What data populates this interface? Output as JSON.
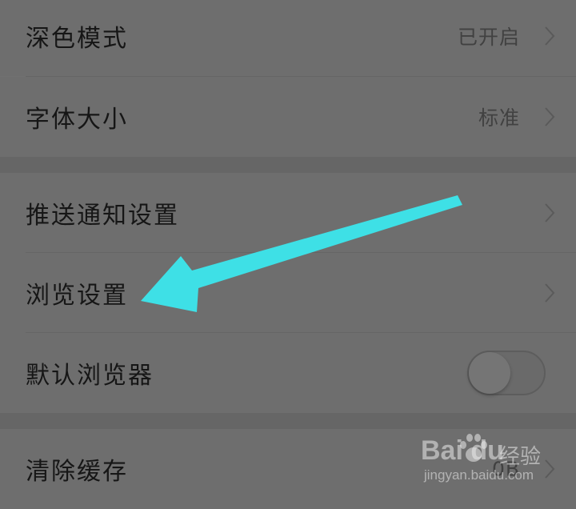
{
  "settings": {
    "dark_mode": {
      "label": "深色模式",
      "value": "已开启"
    },
    "font_size": {
      "label": "字体大小",
      "value": "标准"
    },
    "push_notifications": {
      "label": "推送通知设置"
    },
    "browse_settings": {
      "label": "浏览设置"
    },
    "default_browser": {
      "label": "默认浏览器",
      "enabled": false
    },
    "clear_cache": {
      "label": "清除缓存",
      "value": "0B"
    }
  },
  "annotation": {
    "arrow_color": "#3ee0e6",
    "points_to": "浏览设置"
  },
  "watermark": {
    "logo": "Bai du",
    "product": "经验",
    "url": "jingyan.baidu.com"
  },
  "colors": {
    "overlay_bg": "#707070",
    "text": "#161616",
    "secondary_text": "#414141"
  }
}
